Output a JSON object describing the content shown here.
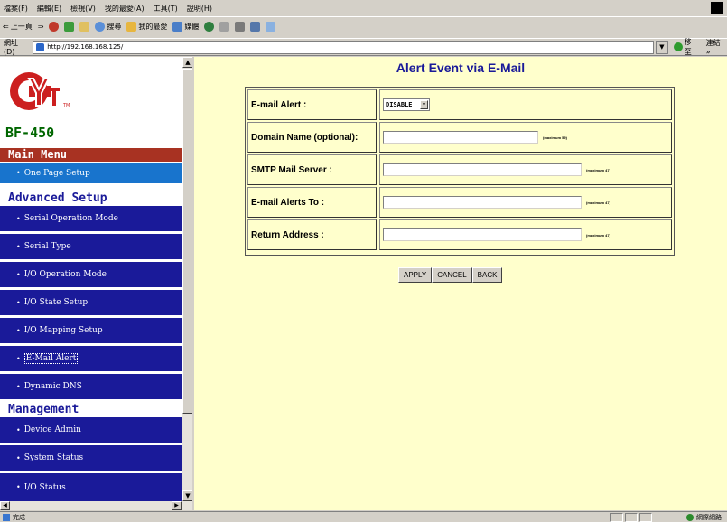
{
  "browser": {
    "menu": [
      "檔案(F)",
      "編輯(E)",
      "檢視(V)",
      "我的最愛(A)",
      "工具(T)",
      "說明(H)"
    ],
    "toolbar": {
      "back_label": "上一頁",
      "search_label": "搜尋",
      "favorites_label": "我的最愛",
      "media_label": "媒體"
    },
    "address_label": "網址(D)",
    "address_value": "http://192.168.168.125/",
    "go_label": "移至",
    "links_label": "連結 »",
    "status_text": "完成",
    "zone_text": "網際網路"
  },
  "sidebar": {
    "model": "BF-450",
    "main_menu": "Main Menu",
    "one_page_setup": "One Page Setup",
    "advanced_setup": "Advanced Setup",
    "advanced_items": [
      "Serial Operation Mode",
      "Serial Type",
      "I/O Operation Mode",
      "I/O State Setup",
      "I/O Mapping Setup",
      "E-Mail Alert",
      "Dynamic DNS"
    ],
    "management": "Management",
    "management_items": [
      "Device Admin",
      "System Status",
      "I/O Status"
    ],
    "bullet": "•"
  },
  "form": {
    "title": "Alert Event via E-Mail",
    "rows": [
      {
        "label": "E-mail Alert :",
        "select_value": "DISABLE"
      },
      {
        "label": "Domain Name (optional):",
        "value": "",
        "hint": "(maximum 59)"
      },
      {
        "label": "SMTP Mail Server :",
        "value": "",
        "hint": "(maximum 47)"
      },
      {
        "label": "E-mail Alerts To :",
        "value": "",
        "hint": "(maximum 47)"
      },
      {
        "label": "Return Address :",
        "value": "",
        "hint": "(maximum 47)"
      }
    ],
    "buttons": {
      "apply": "APPLY",
      "cancel": "CANCEL",
      "back": "BACK"
    }
  },
  "colors": {
    "nav_bg": "#1a1a99",
    "nav_active": "#1874cd",
    "main_menu_bg": "#a83222",
    "content_bg": "#ffffcc",
    "title_color": "#1a1a99",
    "model_color": "#006600"
  }
}
